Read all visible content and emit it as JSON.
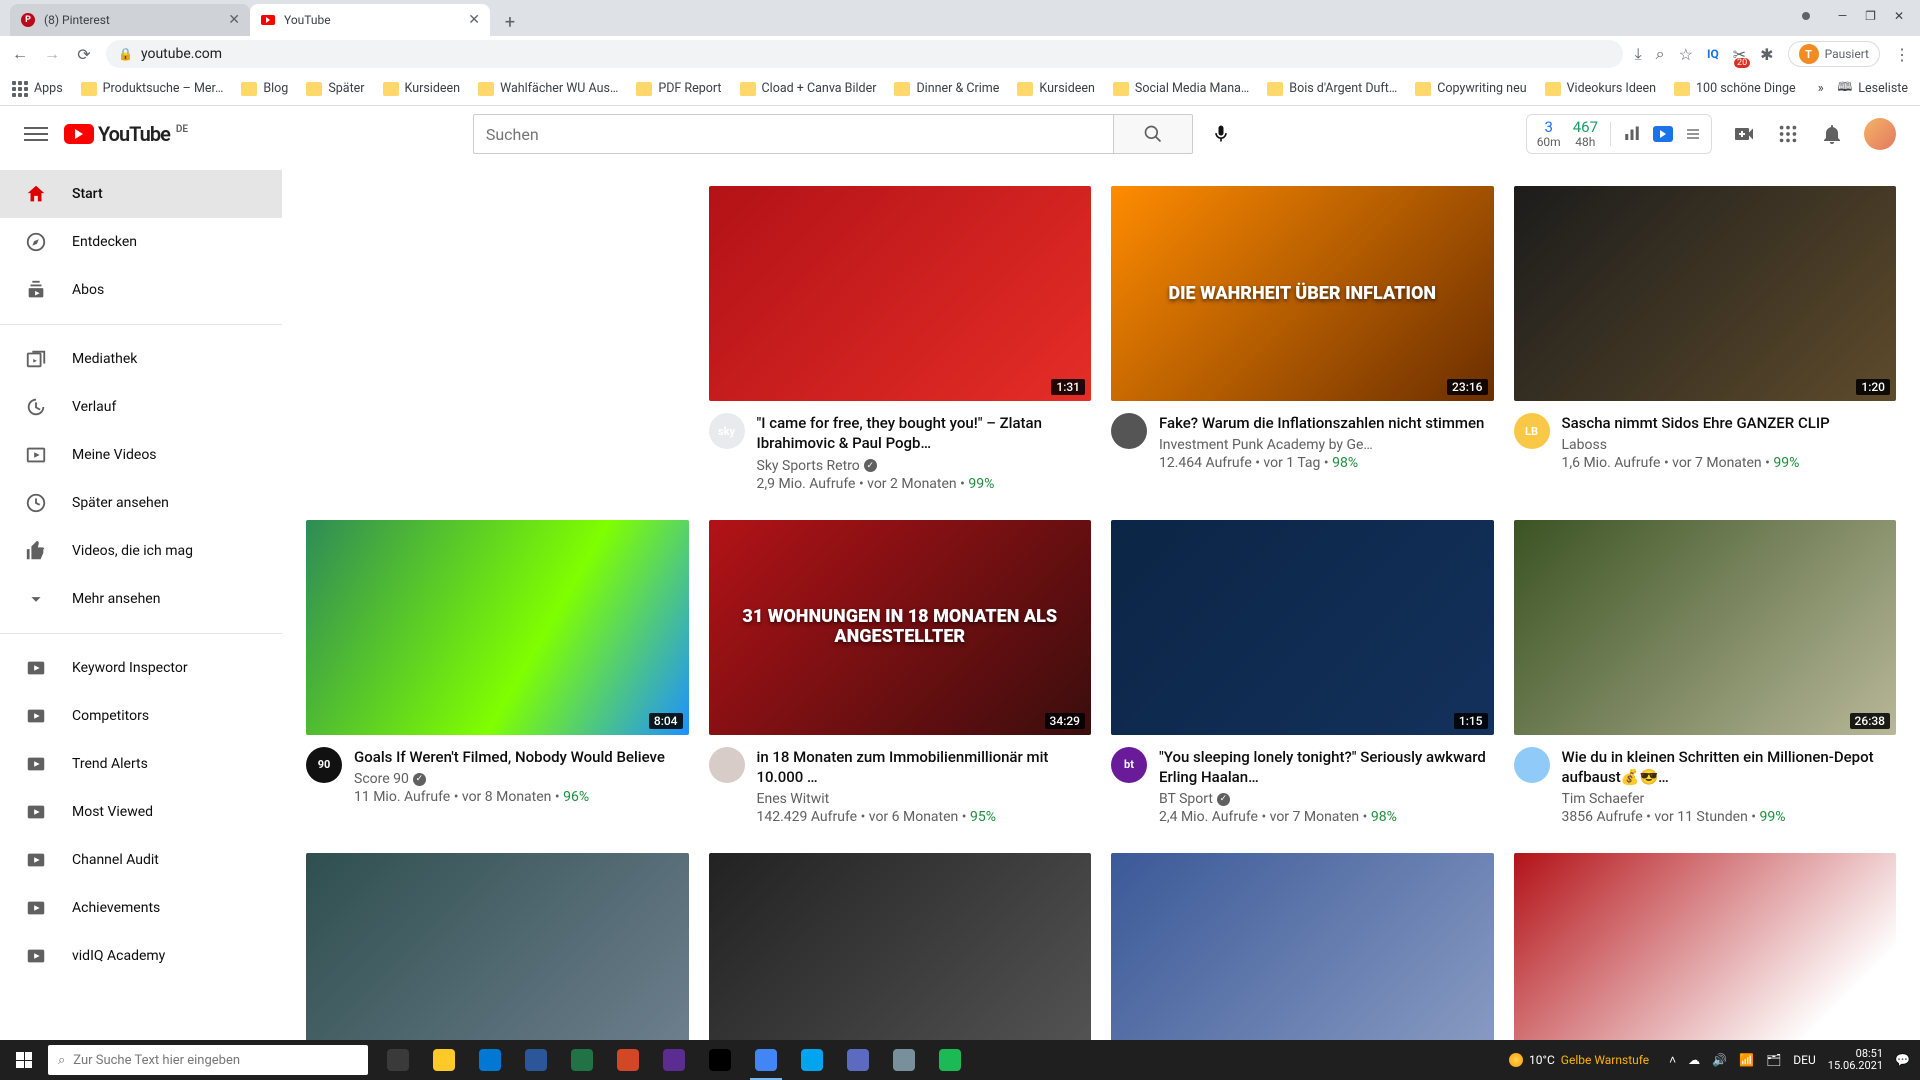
{
  "browser": {
    "tabs": [
      {
        "title": "(8) Pinterest",
        "favicon_color": "#bd081c",
        "favicon_letter": "P"
      },
      {
        "title": "YouTube",
        "favicon_color": "#ff0000",
        "favicon_letter": "▶"
      }
    ],
    "new_tab": "+",
    "win": {
      "min": "—",
      "max": "❐",
      "close": "✕"
    },
    "nav": {
      "back": "←",
      "forward": "→",
      "reload": "⟳"
    },
    "lock": "🔒",
    "url": "youtube.com",
    "omnibox_icons": {
      "install": "⤓",
      "zoom": "⌕",
      "star": "☆",
      "iq": "IQ",
      "ext_count": "20",
      "puzzle": "✱"
    },
    "pausiert_label": "Pausiert",
    "pausiert_letter": "T",
    "menu": "⋮",
    "bookmarks": {
      "apps": "Apps",
      "items": [
        "Produktsuche – Mer…",
        "Blog",
        "Später",
        "Kursideen",
        "Wahlfächer WU Aus…",
        "PDF Report",
        "Cload + Canva Bilder",
        "Dinner & Crime",
        "Kursideen",
        "Social Media Mana…",
        "Bois d'Argent Duft…",
        "Copywriting neu",
        "Videokurs Ideen",
        "100 schöne Dinge"
      ],
      "overflow": "»",
      "leseliste": "Leseliste"
    }
  },
  "youtube": {
    "region": "DE",
    "logo_text": "YouTube",
    "search_placeholder": "Suchen",
    "vidiq": {
      "a_big": "3",
      "a_small": "60m",
      "b_big": "467",
      "b_small": "48h"
    },
    "guide": {
      "primary": [
        {
          "label": "Start",
          "icon": "home"
        },
        {
          "label": "Entdecken",
          "icon": "compass"
        },
        {
          "label": "Abos",
          "icon": "subs"
        }
      ],
      "secondary": [
        {
          "label": "Mediathek",
          "icon": "lib"
        },
        {
          "label": "Verlauf",
          "icon": "history"
        },
        {
          "label": "Meine Videos",
          "icon": "myvids"
        },
        {
          "label": "Später ansehen",
          "icon": "clock"
        },
        {
          "label": "Videos, die ich mag",
          "icon": "like"
        },
        {
          "label": "Mehr ansehen",
          "icon": "expand"
        }
      ],
      "vidiq": [
        "Keyword Inspector",
        "Competitors",
        "Trend Alerts",
        "Most Viewed",
        "Channel Audit",
        "Achievements",
        "vidIQ Academy"
      ]
    },
    "videos": [
      {
        "title": "\"I came for free, they bought you!\" – Zlatan Ibrahimovic & Paul Pogb…",
        "channel": "Sky Sports Retro",
        "verified": true,
        "views": "2,9 Mio. Aufrufe",
        "age": "vor 2 Monaten",
        "pct": "99%",
        "duration": "1:31",
        "thumb_overlay": "",
        "avatar_bg": "#e8eaed",
        "avatar_text": "sky"
      },
      {
        "title": "Fake? Warum die Inflationszahlen nicht stimmen",
        "channel": "Investment Punk Academy by Ge…",
        "verified": false,
        "views": "12.464 Aufrufe",
        "age": "vor 1 Tag",
        "pct": "98%",
        "duration": "23:16",
        "thumb_overlay": "DIE WAHRHEIT ÜBER INFLATION",
        "avatar_bg": "#555",
        "avatar_text": ""
      },
      {
        "title": "Sascha nimmt Sidos Ehre GANZER CLIP",
        "channel": "Laboss",
        "verified": false,
        "views": "1,6 Mio. Aufrufe",
        "age": "vor 7 Monaten",
        "pct": "99%",
        "duration": "1:20",
        "thumb_overlay": "",
        "avatar_bg": "#f9c846",
        "avatar_text": "LB"
      },
      {
        "title": "Goals If Weren't Filmed, Nobody Would Believe",
        "channel": "Score 90",
        "verified": true,
        "views": "11 Mio. Aufrufe",
        "age": "vor 8 Monaten",
        "pct": "96%",
        "duration": "8:04",
        "thumb_overlay": "",
        "avatar_bg": "#111",
        "avatar_text": "90"
      },
      {
        "title": "in 18 Monaten zum Immobilienmillionär mit 10.000 …",
        "channel": "Enes Witwit",
        "verified": false,
        "views": "142.429 Aufrufe",
        "age": "vor 6 Monaten",
        "pct": "95%",
        "duration": "34:29",
        "thumb_overlay": "31 WOHNUNGEN IN 18 MONATEN ALS ANGESTELLTER",
        "avatar_bg": "#d7ccc8",
        "avatar_text": ""
      },
      {
        "title": "\"You sleeping lonely tonight?\" Seriously awkward Erling Haalan…",
        "channel": "BT Sport",
        "verified": true,
        "views": "2,4 Mio. Aufrufe",
        "age": "vor 7 Monaten",
        "pct": "98%",
        "duration": "1:15",
        "thumb_overlay": "",
        "avatar_bg": "#6a1b9a",
        "avatar_text": "bt"
      },
      {
        "title": "Wie du in kleinen Schritten ein Millionen-Depot aufbaust💰😎…",
        "channel": "Tim Schaefer",
        "verified": false,
        "views": "3856 Aufrufe",
        "age": "vor 11 Stunden",
        "pct": "99%",
        "duration": "26:38",
        "thumb_overlay": "",
        "avatar_bg": "#90caf9",
        "avatar_text": ""
      }
    ]
  },
  "taskbar": {
    "search_placeholder": "Zur Suche Text hier eingeben",
    "weather_temp": "10°C",
    "weather_text": "Gelbe Warnstufe",
    "lang": "DEU",
    "time": "08:51",
    "date": "15.06.2021",
    "apps": [
      {
        "bg": "#3a3a3a"
      },
      {
        "bg": "#ffca28"
      },
      {
        "bg": "#0078d4"
      },
      {
        "bg": "#2b579a"
      },
      {
        "bg": "#217346"
      },
      {
        "bg": "#d24726"
      },
      {
        "bg": "#5c2d91"
      },
      {
        "bg": "#000"
      },
      {
        "bg": "#4285f4",
        "active": true
      },
      {
        "bg": "#00a4ef"
      },
      {
        "bg": "#5c6bc0"
      },
      {
        "bg": "#78909c"
      },
      {
        "bg": "#1db954"
      }
    ]
  }
}
